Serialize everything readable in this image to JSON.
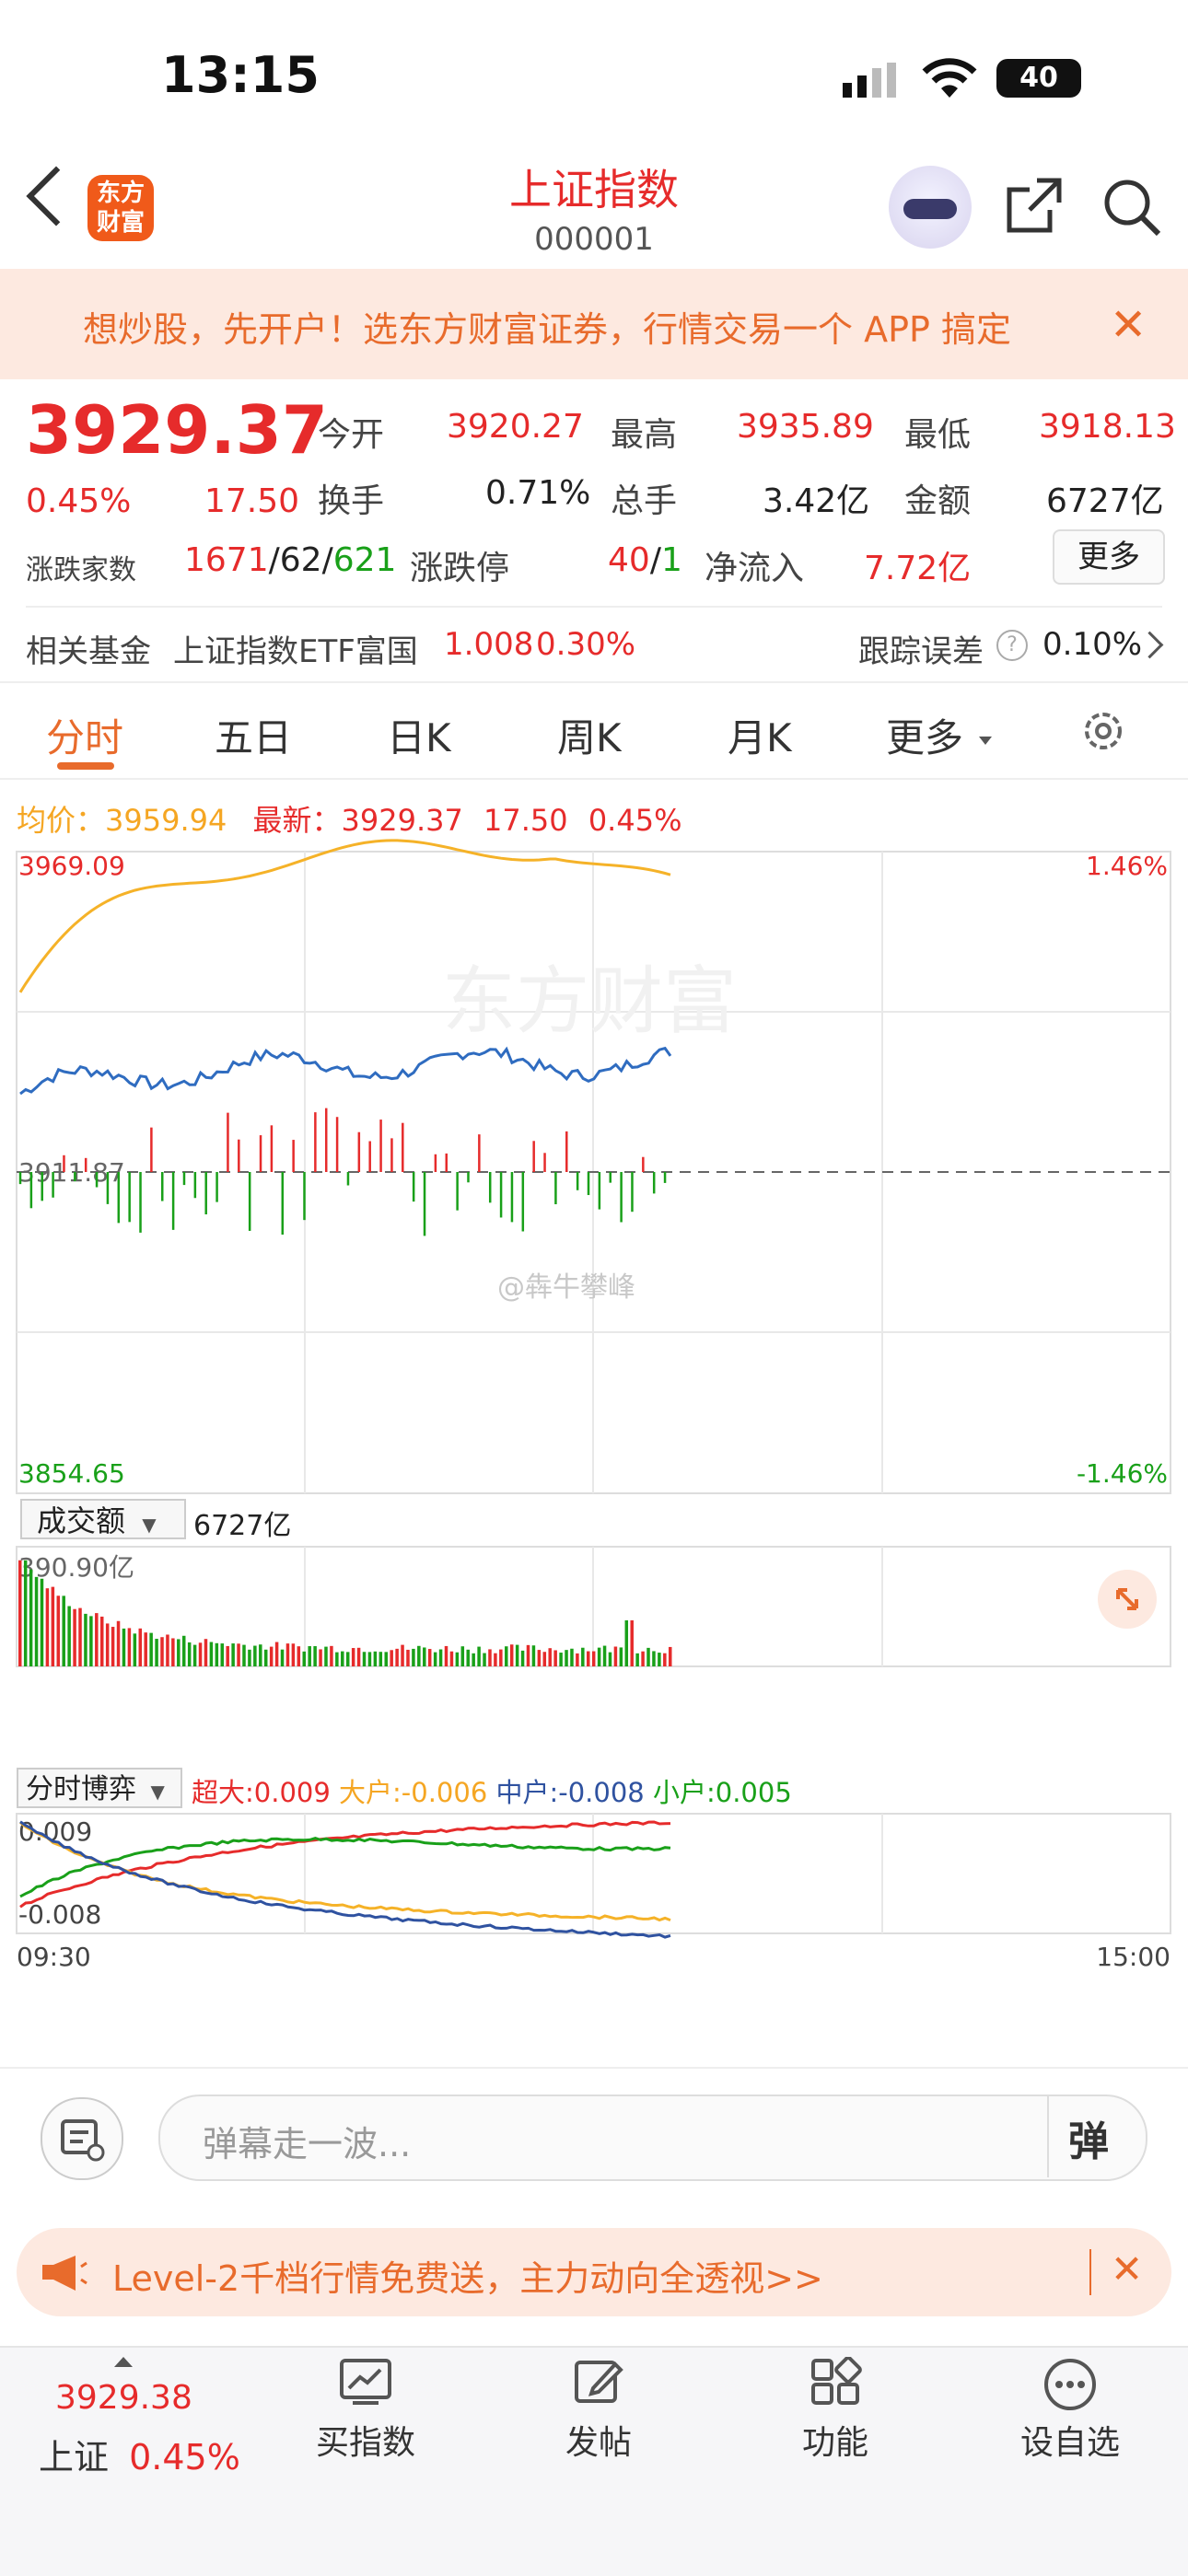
{
  "status_bar": {
    "time": "13:15",
    "battery": "40"
  },
  "header": {
    "title": "上证指数",
    "code": "000001",
    "logo_line1": "东方",
    "logo_line2": "财富"
  },
  "banner": {
    "text": "想炒股，先开户！选东方财富证券，行情交易一个 APP 搞定",
    "close": "✕"
  },
  "quote": {
    "price": "3929.37",
    "change_pct": "0.45%",
    "change": "17.50",
    "open_label": "今开",
    "open": "3920.27",
    "high_label": "最高",
    "high": "3935.89",
    "low_label": "最低",
    "low": "3918.13",
    "turnover_label": "换手",
    "turnover": "0.71%",
    "volume_label": "总手",
    "volume": "3.42亿",
    "amount_label": "金额",
    "amount": "6727亿",
    "adv_label": "涨跌家数",
    "adv_up": "1671",
    "adv_flat": "/62/",
    "adv_down": "621",
    "limit_label": "涨跌停",
    "limit_up": "40",
    "limit_sep": "/",
    "limit_down": "1",
    "inflow_label": "净流入",
    "inflow": "7.72亿",
    "more": "更多"
  },
  "fund": {
    "label": "相关基金",
    "name": "上证指数ETF富国",
    "price": "1.008",
    "pct": "0.30%",
    "error_label": "跟踪误差",
    "error": "0.10%"
  },
  "tabs": [
    "分时",
    "五日",
    "日K",
    "周K",
    "月K",
    "更多"
  ],
  "intraday": {
    "avg_label": "均价：",
    "avg": "3959.94",
    "latest_label": "最新：",
    "latest": "3929.37",
    "chg": "17.50",
    "pct": "0.45%",
    "y_top": "3969.09",
    "y_mid": "3911.87",
    "y_bottom": "3854.65",
    "pct_top": "1.46%",
    "pct_bottom": "-1.46%",
    "watermark": "东方财富",
    "weibo": "@犇牛攀峰"
  },
  "volume_panel": {
    "selector": "成交额",
    "total": "6727亿",
    "max": "390.90亿"
  },
  "flow_panel": {
    "selector": "分时博弈",
    "super_label": "超大:0.009",
    "big_label": "大户:-0.006",
    "mid_label": "中户:-0.008",
    "small_label": "小户:0.005",
    "y_top": "0.009",
    "y_bottom": "-0.008",
    "x_start": "09:30",
    "x_end": "15:00"
  },
  "comment": {
    "placeholder": "弹幕走一波...",
    "danmu_btn": "弹"
  },
  "promo": {
    "text": "Level-2千档行情免费送，主力动向全透视>>"
  },
  "bottom_nav": {
    "index_price": "3929.38",
    "index_name": "上证",
    "index_pct": "0.45%",
    "buy": "买指数",
    "post": "发帖",
    "func": "功能",
    "watch": "设自选"
  },
  "colors": {
    "up": "#e62b2b",
    "down": "#19a019",
    "accent": "#e86b2c",
    "avg_line": "#f5b228",
    "price_line": "#2f6cc0"
  }
}
